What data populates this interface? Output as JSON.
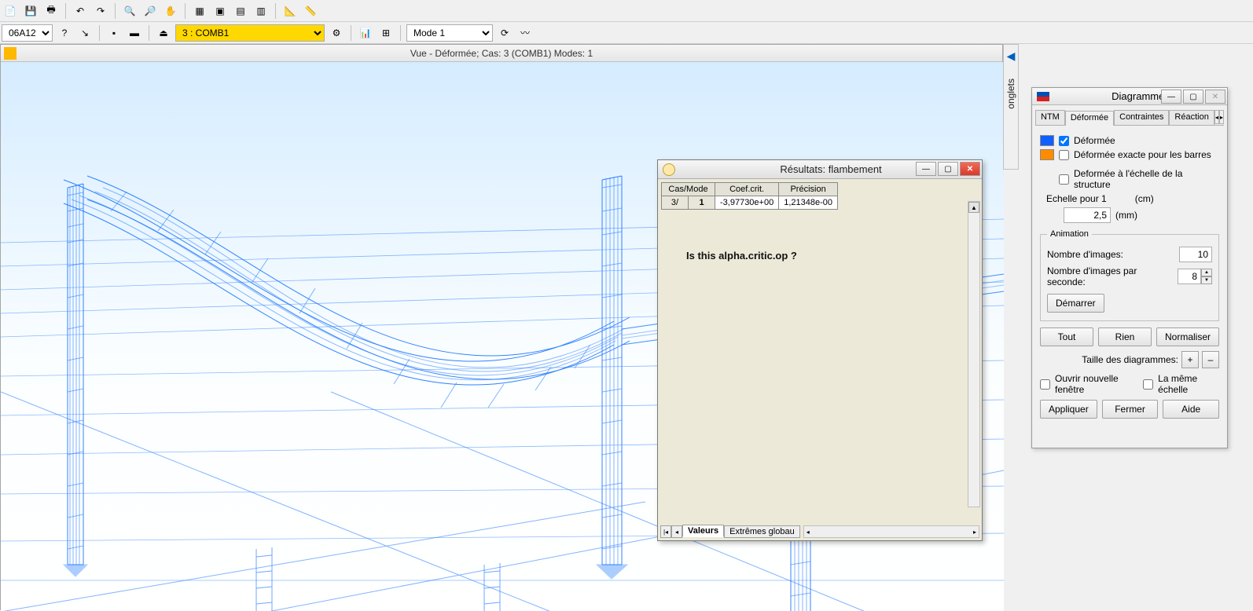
{
  "toolbar": {
    "combo1": "06A12",
    "combo_load": "3 : COMB1",
    "combo_mode": "Mode  1"
  },
  "view": {
    "title": "Vue - Déformée; Cas: 3 (COMB1) Modes: 1"
  },
  "onglets": {
    "label": "onglets"
  },
  "results": {
    "title": "Résultats: flambement",
    "headers": {
      "casmode": "Cas/Mode",
      "coef": "Coef.crit.",
      "prec": "Précision"
    },
    "row": {
      "cas": "3/",
      "mode": "1",
      "coef": "-3,97730e+00",
      "prec": "1,21348e-00"
    },
    "note": "Is this alpha.critic.op ?",
    "tabs": {
      "valeurs": "Valeurs",
      "extremes": "Extrêmes globau"
    }
  },
  "panel": {
    "title": "Diagrammes",
    "tabs": {
      "ntm": "NTM",
      "deformee": "Déformée",
      "contraintes": "Contraintes",
      "reaction": "Réaction"
    },
    "checks": {
      "deformee": "Déformée",
      "exacte": "Déformée exacte pour les barres",
      "echelle_struct": "Deformée à l'échelle de la structure"
    },
    "scale": {
      "label1": "Echelle pour 1",
      "unit1": "(cm)",
      "value": "2,5",
      "unit2": "(mm)"
    },
    "anim": {
      "legend": "Animation",
      "images_label": "Nombre d'images:",
      "images_val": "10",
      "fps_label": "Nombre d'images par seconde:",
      "fps_val": "8",
      "start": "Démarrer"
    },
    "buttons": {
      "tout": "Tout",
      "rien": "Rien",
      "normaliser": "Normaliser"
    },
    "size_label": "Taille des diagrammes:",
    "footer_checks": {
      "nouvelle": "Ouvrir nouvelle fenêtre",
      "meme": "La même échelle"
    },
    "footer_buttons": {
      "appliquer": "Appliquer",
      "fermer": "Fermer",
      "aide": "Aide"
    }
  }
}
